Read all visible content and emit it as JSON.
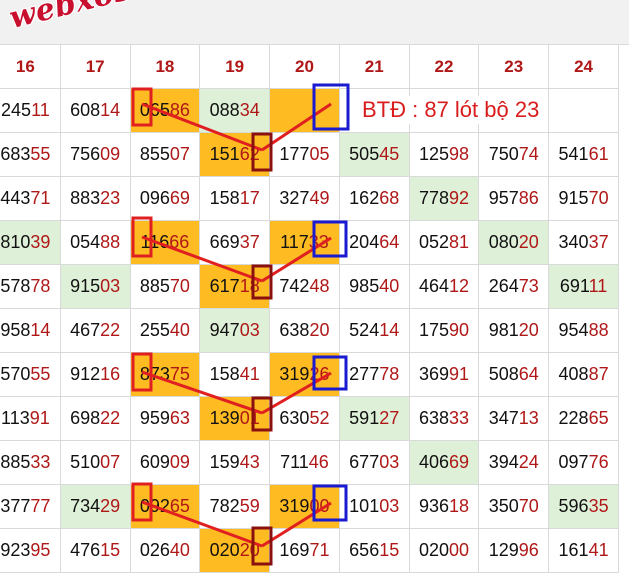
{
  "watermark": "webxoso.net",
  "note": "BTĐ : 87 lót bộ 23",
  "columns": [
    "16",
    "17",
    "18",
    "19",
    "20",
    "21",
    "22",
    "23",
    "24"
  ],
  "colors": {
    "highlight_orange": "#ffbb22",
    "highlight_green": "#dff0d8",
    "mark_red": "#e02020",
    "mark_blue": "#1a1ad0",
    "digit_red": "#b01818"
  },
  "rows": [
    [
      {
        "v": "24511"
      },
      {
        "v": "60814"
      },
      {
        "v": "06586",
        "bg": "o"
      },
      {
        "v": "08834",
        "bg": "g"
      },
      {
        "v": "",
        "bg": "o"
      },
      {
        "v": ""
      },
      {
        "v": ""
      },
      {
        "v": ""
      },
      {
        "v": ""
      }
    ],
    [
      {
        "v": "68355"
      },
      {
        "v": "75609"
      },
      {
        "v": "85507"
      },
      {
        "v": "15162",
        "bg": "o"
      },
      {
        "v": "17705"
      },
      {
        "v": "50545",
        "bg": "g"
      },
      {
        "v": "12598"
      },
      {
        "v": "75074"
      },
      {
        "v": "54161"
      }
    ],
    [
      {
        "v": "44371"
      },
      {
        "v": "88323"
      },
      {
        "v": "09669"
      },
      {
        "v": "15817"
      },
      {
        "v": "32749"
      },
      {
        "v": "16268"
      },
      {
        "v": "77892",
        "bg": "g"
      },
      {
        "v": "95786"
      },
      {
        "v": "91570"
      }
    ],
    [
      {
        "v": "81039",
        "bg": "g"
      },
      {
        "v": "05488"
      },
      {
        "v": "11666",
        "bg": "o"
      },
      {
        "v": "66937"
      },
      {
        "v": "11733",
        "bg": "o"
      },
      {
        "v": "20464"
      },
      {
        "v": "05281"
      },
      {
        "v": "08020",
        "bg": "g"
      },
      {
        "v": "34037"
      }
    ],
    [
      {
        "v": "57878"
      },
      {
        "v": "91503",
        "bg": "g"
      },
      {
        "v": "88570"
      },
      {
        "v": "61718",
        "bg": "o"
      },
      {
        "v": "74248"
      },
      {
        "v": "98540"
      },
      {
        "v": "46412"
      },
      {
        "v": "26473"
      },
      {
        "v": "69111",
        "bg": "g"
      }
    ],
    [
      {
        "v": "95814"
      },
      {
        "v": "46722"
      },
      {
        "v": "25540"
      },
      {
        "v": "94703",
        "bg": "g"
      },
      {
        "v": "63820"
      },
      {
        "v": "52414"
      },
      {
        "v": "17590"
      },
      {
        "v": "98120"
      },
      {
        "v": "95488"
      }
    ],
    [
      {
        "v": "57055"
      },
      {
        "v": "91216"
      },
      {
        "v": "87375",
        "bg": "o"
      },
      {
        "v": "15841"
      },
      {
        "v": "31926",
        "bg": "o"
      },
      {
        "v": "27778"
      },
      {
        "v": "36991"
      },
      {
        "v": "50864"
      },
      {
        "v": "40887"
      }
    ],
    [
      {
        "v": "11391"
      },
      {
        "v": "69822"
      },
      {
        "v": "95963"
      },
      {
        "v": "13901",
        "bg": "o"
      },
      {
        "v": "63052"
      },
      {
        "v": "59127",
        "bg": "g"
      },
      {
        "v": "63833"
      },
      {
        "v": "34713"
      },
      {
        "v": "22865"
      }
    ],
    [
      {
        "v": "88533"
      },
      {
        "v": "51007"
      },
      {
        "v": "60909"
      },
      {
        "v": "15943"
      },
      {
        "v": "71146"
      },
      {
        "v": "67703"
      },
      {
        "v": "40669",
        "bg": "g"
      },
      {
        "v": "39424"
      },
      {
        "v": "09776"
      }
    ],
    [
      {
        "v": "37777"
      },
      {
        "v": "73429",
        "bg": "g"
      },
      {
        "v": "09265",
        "bg": "o"
      },
      {
        "v": "78259"
      },
      {
        "v": "31900",
        "bg": "o"
      },
      {
        "v": "10103"
      },
      {
        "v": "93618"
      },
      {
        "v": "35070"
      },
      {
        "v": "59635",
        "bg": "g"
      }
    ],
    [
      {
        "v": "92395"
      },
      {
        "v": "47615"
      },
      {
        "v": "02640"
      },
      {
        "v": "02020",
        "bg": "o"
      },
      {
        "v": "16971"
      },
      {
        "v": "65615"
      },
      {
        "v": "02000"
      },
      {
        "v": "12996"
      },
      {
        "v": "16141"
      }
    ]
  ]
}
